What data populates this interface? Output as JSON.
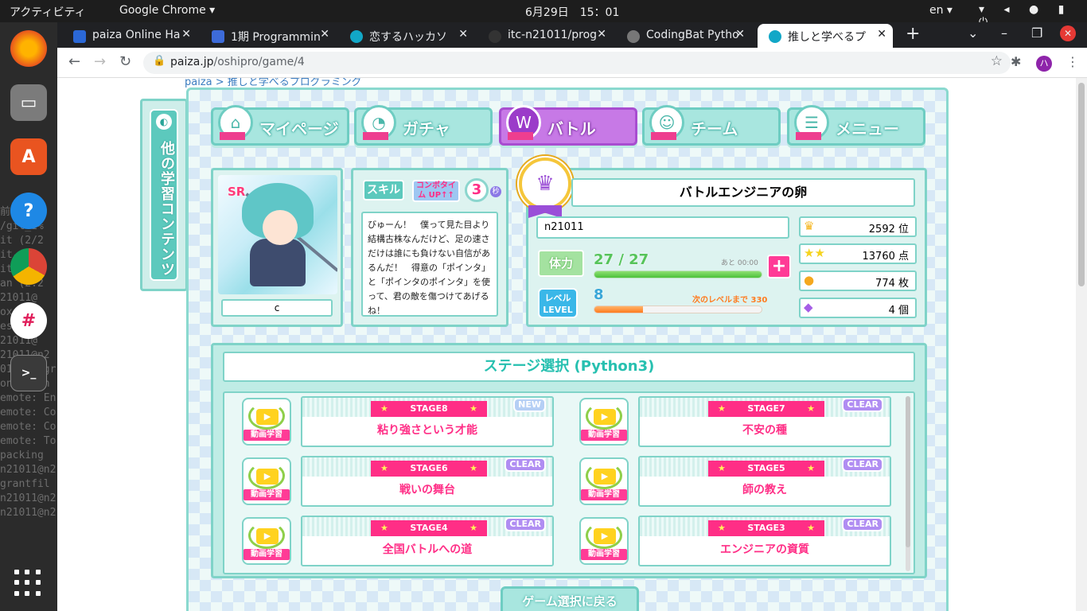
{
  "os": {
    "activities": "アクティビティ",
    "app_name": "Google Chrome ▾",
    "clock": "6月29日　15：01",
    "lang": "en ▾",
    "tray_icons": [
      "wifi-icon",
      "volume-icon",
      "mic-icon",
      "battery-icon",
      "power-icon"
    ]
  },
  "dock": {
    "apps": [
      "firefox-icon",
      "files-icon",
      "software-icon",
      "help-icon",
      "chrome-icon",
      "slack-icon",
      "terminal-icon",
      "app-grid-icon"
    ],
    "terminal_bg": "前の選\n/git_1%\nit (2/2\nit-n2\nit (1:2\nan (2:2\n21011@\noxes\nesktop\n21011@\n21011@n2\n011/progr\noning in\nemote: En\nemote: Co\nemote: Co\nemote: To\npacking\nn21011@n2\ngrantfil\nn21011@n2\nn21011@n2"
  },
  "browser": {
    "tabs": [
      {
        "title": "paiza Online Ha",
        "icon_color": "#2b68d6"
      },
      {
        "title": "1期 Programmin",
        "icon_color": "#3d6bd9"
      },
      {
        "title": "恋するハッカソ",
        "icon_color": "#12a7c7"
      },
      {
        "title": "itc-n21011/prog",
        "icon_color": "#333333"
      },
      {
        "title": "CodingBat Pytho",
        "icon_color": "#777777"
      },
      {
        "title": "推しと学べるプ",
        "icon_color": "#12a7c7"
      }
    ],
    "active_tab_index": 5,
    "url_host": "paiza.jp",
    "url_path": "/oshipro/game/4",
    "profile_initial": "ハ"
  },
  "page": {
    "breadcrumb": "paiza > 推しと学べるプログラミング",
    "side_menu": "他の学習コンテンツ",
    "nav": [
      {
        "label": "マイページ",
        "icon": "house-icon",
        "active": false
      },
      {
        "label": "ガチャ",
        "icon": "gacha-icon",
        "active": false
      },
      {
        "label": "バトル",
        "icon": "battle-icon",
        "active": true
      },
      {
        "label": "チーム",
        "icon": "team-icon",
        "active": false
      },
      {
        "label": "メニュー",
        "icon": "list-icon",
        "active": false
      }
    ],
    "character": {
      "rarity": "SR",
      "name": "c"
    },
    "skill": {
      "tag": "スキル",
      "combo_label": "コンボタイム UP↑↑",
      "combo_value": "3",
      "combo_unit": "秒",
      "text": "びゅーん！　僕って見た目より結構古株なんだけど、足の速さだけは誰にも負けない自信があるんだ！　得意の「ポインタ」と「ポインタのポインタ」を使って、君の敵を傷つけてあげるね！"
    },
    "status": {
      "title": "バトルエンジニアの卵",
      "username": "n21011",
      "hp_label": "体力",
      "hp_value": "27 / 27",
      "hp_note": "あと 00:00",
      "hp_fraction": 1.0,
      "level_label": "レベル LEVEL",
      "level_value": "8",
      "level_note": "次のレベルまで 330",
      "level_fraction": 0.29,
      "rank": "2592 位",
      "points": "13760 点",
      "coins": "774 枚",
      "gems": "4 個"
    },
    "stage_title": "ステージ選択 (Python3)",
    "video_label": "動画学習",
    "stages": [
      {
        "no": "STAGE8",
        "name": "粘り強さという才能",
        "badge": "NEW"
      },
      {
        "no": "STAGE7",
        "name": "不安の種",
        "badge": "CLEAR"
      },
      {
        "no": "STAGE6",
        "name": "戦いの舞台",
        "badge": "CLEAR"
      },
      {
        "no": "STAGE5",
        "name": "師の教え",
        "badge": "CLEAR"
      },
      {
        "no": "STAGE4",
        "name": "全国バトルへの道",
        "badge": "CLEAR"
      },
      {
        "no": "STAGE3",
        "name": "エンジニアの資質",
        "badge": "CLEAR"
      }
    ],
    "back_button": "ゲーム選択に戻る"
  }
}
